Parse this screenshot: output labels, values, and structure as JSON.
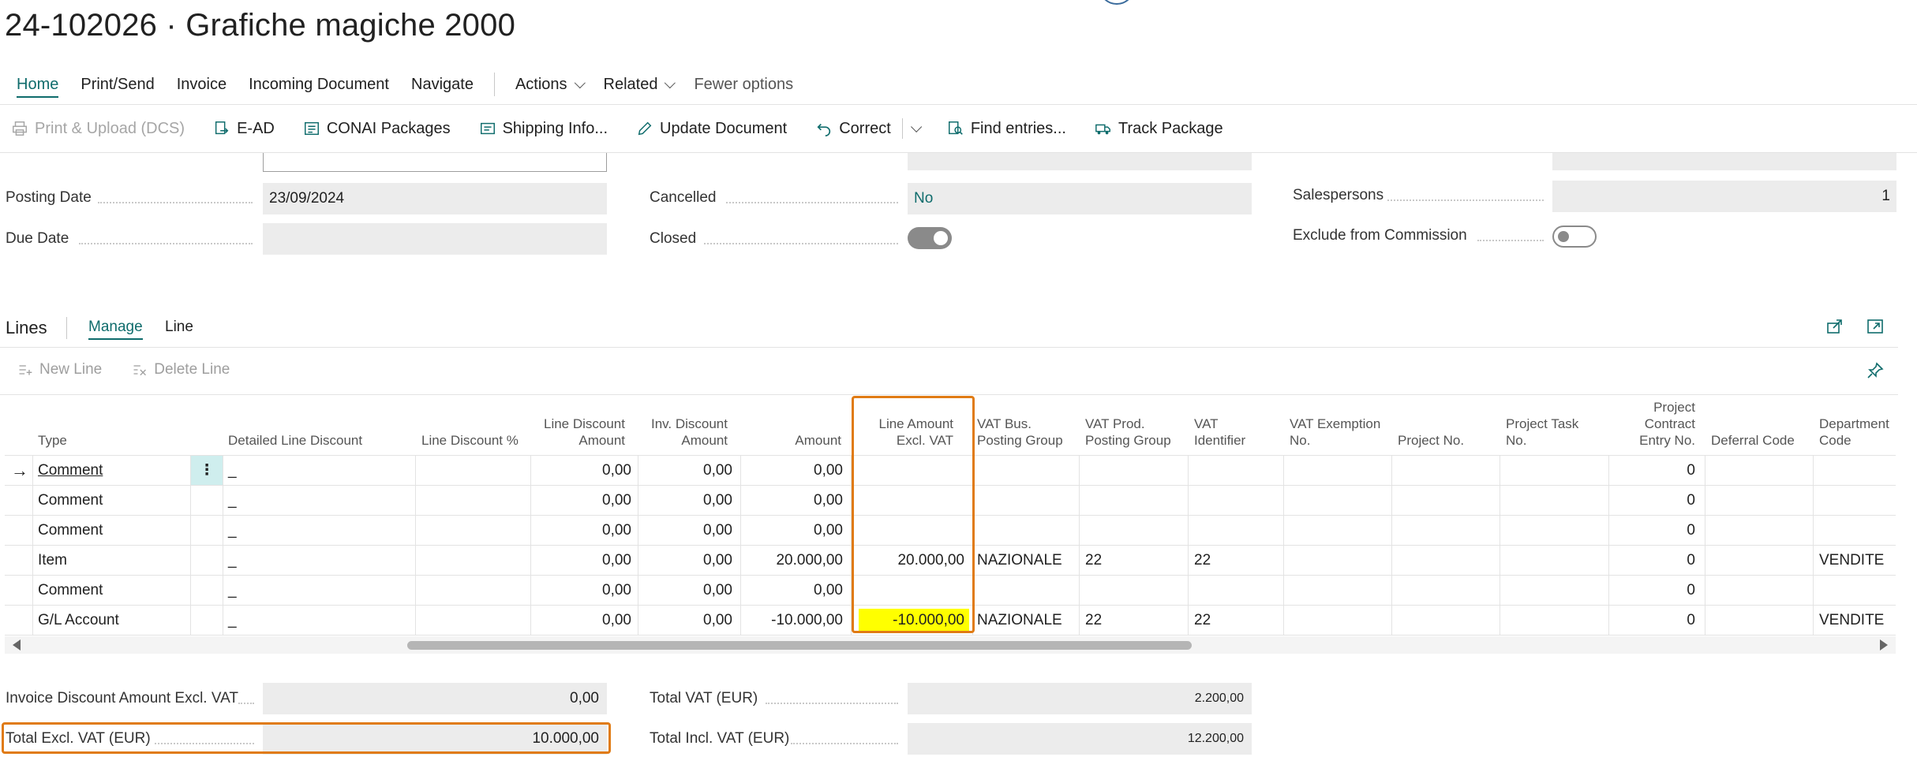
{
  "page": {
    "title": "24-102026 · Grafiche magiche 2000"
  },
  "nav": {
    "home": "Home",
    "print_send": "Print/Send",
    "invoice": "Invoice",
    "incoming_document": "Incoming Document",
    "navigate": "Navigate",
    "actions": "Actions",
    "related": "Related",
    "fewer_options": "Fewer options"
  },
  "toolbar": {
    "print_upload": "Print & Upload (DCS)",
    "ead": "E-AD",
    "conai": "CONAI Packages",
    "shipping": "Shipping Info...",
    "update_document": "Update Document",
    "correct": "Correct",
    "find_entries": "Find entries...",
    "track_package": "Track Package"
  },
  "header_fields": {
    "posting_date_label": "Posting Date",
    "posting_date_value": "23/09/2024",
    "due_date_label": "Due Date",
    "due_date_value": "",
    "cancelled_label": "Cancelled",
    "cancelled_value": "No",
    "closed_label": "Closed",
    "closed_on": true,
    "salespersons_label": "Salespersons",
    "salespersons_value": "1",
    "exclude_commission_label": "Exclude from Commission",
    "exclude_commission_on": false
  },
  "lines": {
    "title": "Lines",
    "tab_manage": "Manage",
    "tab_line": "Line",
    "new_line": "New Line",
    "delete_line": "Delete Line",
    "columns": {
      "type": "Type",
      "detailed_line_discount": "Detailed Line Discount",
      "line_discount_pct": "Line Discount %",
      "line_discount_amount_1": "Line Discount",
      "line_discount_amount_2": "Amount",
      "inv_discount_amount_1": "Inv. Discount",
      "inv_discount_amount_2": "Amount",
      "amount": "Amount",
      "line_amount_excl_vat_1": "Line Amount",
      "line_amount_excl_vat_2": "Excl. VAT",
      "vat_bus_1": "VAT Bus.",
      "vat_bus_2": "Posting Group",
      "vat_prod_1": "VAT Prod.",
      "vat_prod_2": "Posting Group",
      "vat_identifier_1": "VAT",
      "vat_identifier_2": "Identifier",
      "vat_exemption_1": "VAT Exemption",
      "vat_exemption_2": "No.",
      "project_no": "Project No.",
      "project_task_1": "Project Task",
      "project_task_2": "No.",
      "project_contract_1": "Project",
      "project_contract_2": "Contract",
      "project_contract_3": "Entry No.",
      "deferral_code": "Deferral Code",
      "department_1": "Department",
      "department_2": "Code"
    },
    "rows": [
      {
        "type": "Comment",
        "detail": "_",
        "line_disc_amt": "0,00",
        "inv_disc_amt": "0,00",
        "amount": "0,00",
        "line_amt_excl_vat": "",
        "vat_bus": "",
        "vat_prod": "",
        "vat_id": "",
        "project_contract": "0",
        "department": ""
      },
      {
        "type": "Comment",
        "detail": "_",
        "line_disc_amt": "0,00",
        "inv_disc_amt": "0,00",
        "amount": "0,00",
        "line_amt_excl_vat": "",
        "vat_bus": "",
        "vat_prod": "",
        "vat_id": "",
        "project_contract": "0",
        "department": ""
      },
      {
        "type": "Comment",
        "detail": "_",
        "line_disc_amt": "0,00",
        "inv_disc_amt": "0,00",
        "amount": "0,00",
        "line_amt_excl_vat": "",
        "vat_bus": "",
        "vat_prod": "",
        "vat_id": "",
        "project_contract": "0",
        "department": ""
      },
      {
        "type": "Item",
        "detail": "_",
        "line_disc_amt": "0,00",
        "inv_disc_amt": "0,00",
        "amount": "20.000,00",
        "line_amt_excl_vat": "20.000,00",
        "vat_bus": "NAZIONALE",
        "vat_prod": "22",
        "vat_id": "22",
        "project_contract": "0",
        "department": "VENDITE"
      },
      {
        "type": "Comment",
        "detail": "_",
        "line_disc_amt": "0,00",
        "inv_disc_amt": "0,00",
        "amount": "0,00",
        "line_amt_excl_vat": "",
        "vat_bus": "",
        "vat_prod": "",
        "vat_id": "",
        "project_contract": "0",
        "department": ""
      },
      {
        "type": "G/L Account",
        "detail": "_",
        "line_disc_amt": "0,00",
        "inv_disc_amt": "0,00",
        "amount": "-10.000,00",
        "line_amt_excl_vat": "-10.000,00",
        "vat_bus": "NAZIONALE",
        "vat_prod": "22",
        "vat_id": "22",
        "project_contract": "0",
        "department": "VENDITE"
      }
    ]
  },
  "totals": {
    "inv_discount_label": "Invoice Discount Amount Excl. VAT",
    "inv_discount_value": "0,00",
    "total_excl_vat_label": "Total Excl. VAT (EUR)",
    "total_excl_vat_value": "10.000,00",
    "total_vat_label": "Total VAT (EUR)",
    "total_vat_value": "2.200,00",
    "total_incl_vat_label": "Total Incl. VAT (EUR)",
    "total_incl_vat_value": "12.200,00"
  },
  "colors": {
    "accent": "#0f6c6c",
    "highlight_orange": "#e07b14",
    "highlight_yellow": "#ffff00"
  }
}
